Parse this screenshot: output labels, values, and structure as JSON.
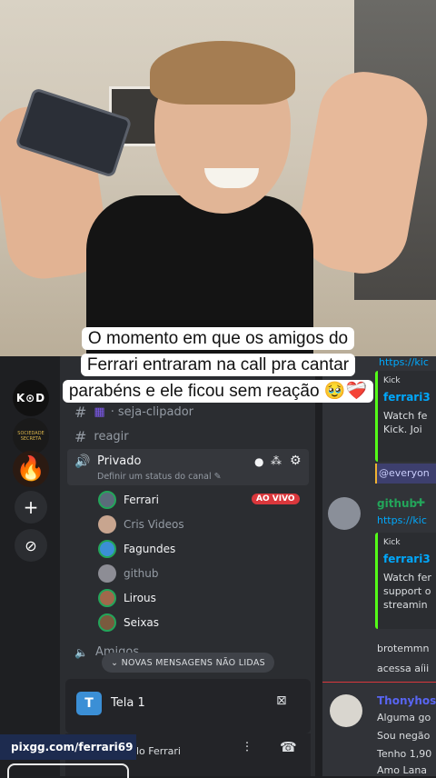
{
  "caption": {
    "line1": "O momento em que os amigos do",
    "line2": "Ferrari entraram na call pra cantar",
    "line3": "parabéns e ele ficou sem reação 🥹❤️‍🩹"
  },
  "servers": {
    "kod_label": "K⊙D",
    "secret_label": "SOCIEDADE SECRETA",
    "fire_glyph": "🔥",
    "add_glyph": "+",
    "discover_glyph": "⊘"
  },
  "channels": {
    "seja_clipador": "seja-clipador",
    "reagir": "reagir",
    "voice_name": "Privado",
    "voice_status": "Definir um status do canal ✎",
    "users": [
      {
        "name": "Ferrari"
      },
      {
        "name": "Cris Videos"
      },
      {
        "name": "Fagundes"
      },
      {
        "name": "github"
      },
      {
        "name": "Lirous"
      },
      {
        "name": "Seixas"
      }
    ],
    "live_badge": "AO VIVO",
    "next_channel": "Amigos",
    "new_messages": "⌄  NOVAS MENSAGENS NÃO LIDAS",
    "screen_label": "Tela 1",
    "screen_icon": "T",
    "user_label": "lo Ferrari"
  },
  "promo": {
    "pix": "pixgg.com/ferrari69"
  },
  "chat": {
    "top_link": "https://kic",
    "embed1_provider": "Kick",
    "embed1_title": "ferrari3",
    "embed1_desc1": "Watch fe",
    "embed1_desc2": "Kick. Joi",
    "everyone": "@everyon",
    "bot_name": "github",
    "bot_link": "https://kic",
    "embed2_provider": "Kick",
    "embed2_title": "ferrari3",
    "embed2_desc1": "Watch fer",
    "embed2_desc2": "support o",
    "embed2_desc3": "streamin",
    "line_brotem": "brotemmn",
    "line_acessa": "acessa aíii",
    "user2_name": "Thonyhos",
    "line_alguma": "Alguma go",
    "line_sou": "Sou negão",
    "line_tenho": "Tenho 1,90",
    "line_amo": "Amo Lana"
  },
  "colors": {
    "online": "#23a55a",
    "live": "#da373c",
    "kick_green": "#53fc18",
    "link": "#00a8fc"
  }
}
